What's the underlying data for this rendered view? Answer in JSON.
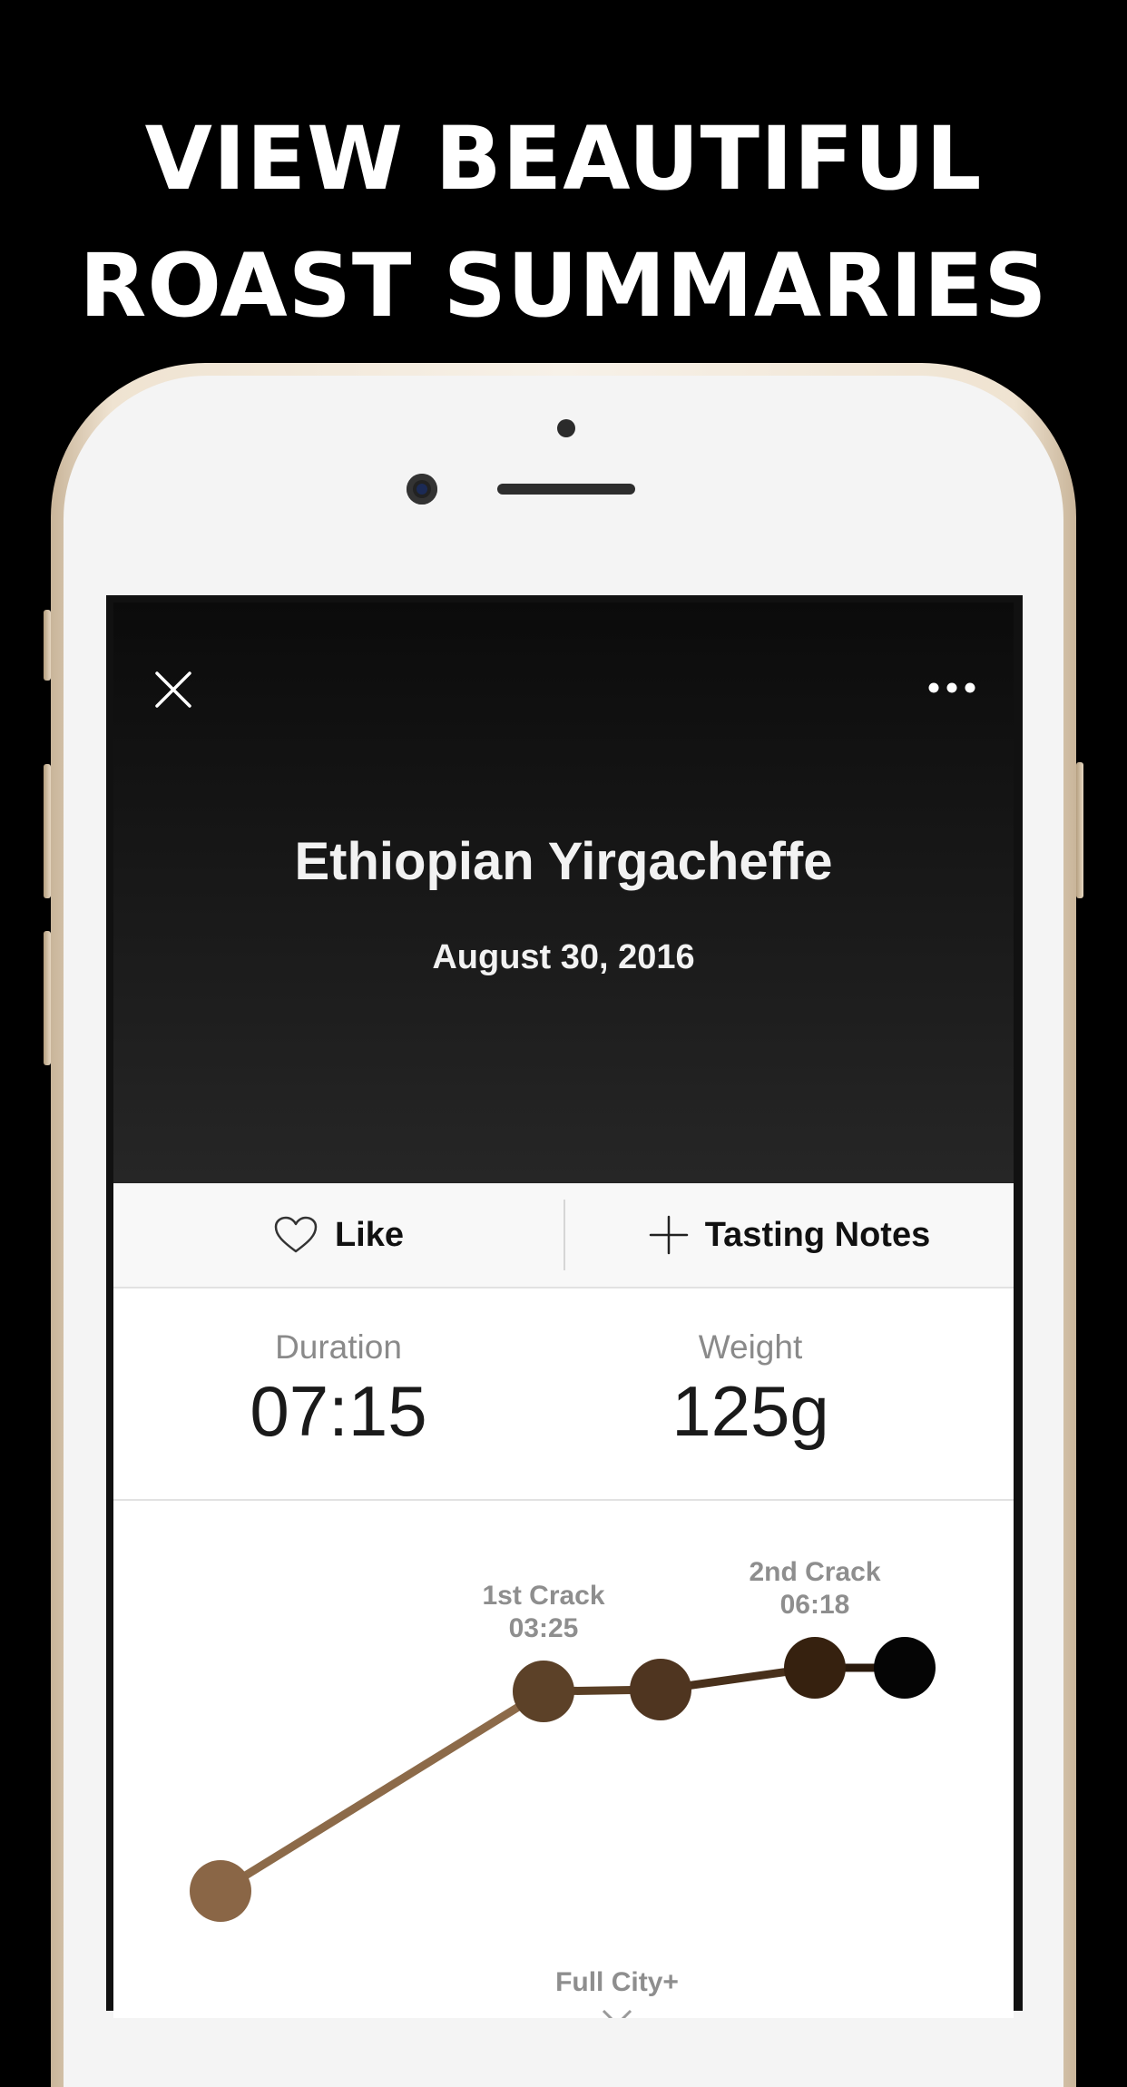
{
  "headline": {
    "line1": "VIEW BEAUTIFUL",
    "line2": "ROAST SUMMARIES"
  },
  "roast": {
    "bean": "Ethiopian Yirgacheffe",
    "date": "August 30, 2016",
    "close_icon": "close-icon",
    "more_icon": "more-icon"
  },
  "actions": {
    "like_label": "Like",
    "like_icon": "heart-icon",
    "notes_label": "Tasting Notes",
    "notes_icon": "plus-icon"
  },
  "stats": {
    "duration_label": "Duration",
    "duration_value": "07:15",
    "weight_label": "Weight",
    "weight_value": "125g"
  },
  "chart_data": {
    "type": "line",
    "title": "",
    "milestones": [
      {
        "label": "",
        "color": "#8a6646"
      },
      {
        "label": "1st Crack",
        "time": "03:25",
        "color": "#5c4128"
      },
      {
        "label": "",
        "color": "#4f3520"
      },
      {
        "label": "2nd Crack",
        "time": "06:18",
        "color": "#36210f"
      },
      {
        "label": "",
        "color": "#050505"
      }
    ],
    "roast_level": "Full City+",
    "line_colors": [
      "#8c6a49",
      "#5a3f25",
      "#48301b",
      "#2a1a0c"
    ]
  }
}
